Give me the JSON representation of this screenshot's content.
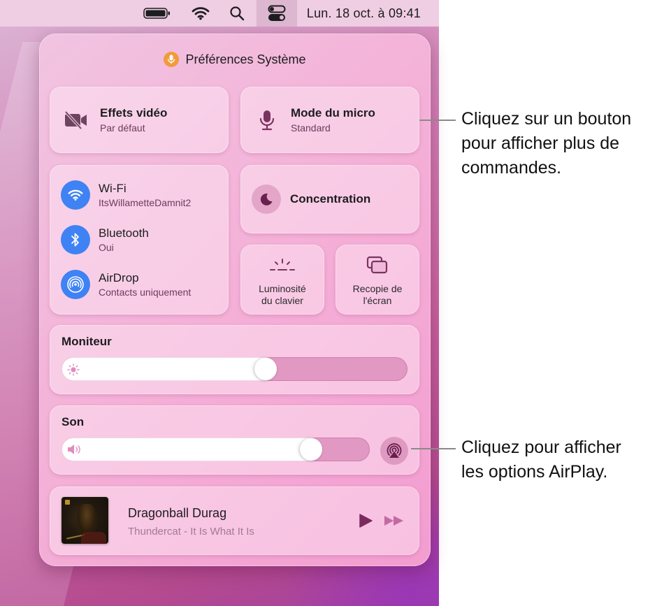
{
  "menubar": {
    "icons": [
      "battery-icon",
      "wifi-icon",
      "search-icon",
      "control-center-icon"
    ],
    "clock": "Lun. 18 oct. à  09:41"
  },
  "panel": {
    "header": {
      "icon": "microphone-icon",
      "icon_color": "#f19b3a",
      "title": "Préférences Système"
    },
    "video_effects": {
      "icon": "video-off-icon",
      "label": "Effets vidéo",
      "value": "Par défaut"
    },
    "mic_mode": {
      "icon": "microphone-icon",
      "label": "Mode du micro",
      "value": "Standard"
    },
    "connectivity": [
      {
        "icon": "wifi-icon",
        "label": "Wi-Fi",
        "value": "ItsWillametteDamnit2"
      },
      {
        "icon": "bluetooth-icon",
        "label": "Bluetooth",
        "value": "Oui"
      },
      {
        "icon": "airdrop-icon",
        "label": "AirDrop",
        "value": "Contacts uniquement"
      }
    ],
    "connectivity_color": "#3f82f4",
    "focus": {
      "icon": "moon-icon",
      "label": "Concentration"
    },
    "keyboard_brightness": {
      "icon": "keyboard-brightness-icon",
      "label_line1": "Luminosité",
      "label_line2": "du clavier"
    },
    "screen_mirroring": {
      "icon": "screen-mirroring-icon",
      "label_line1": "Recopie de",
      "label_line2": "l'écran"
    },
    "display": {
      "label": "Moniteur",
      "icon": "sun-icon",
      "level": 0.59
    },
    "sound": {
      "label": "Son",
      "icon": "speaker-icon",
      "level": 0.81,
      "airplay_icon": "airplay-audio-icon"
    },
    "now_playing": {
      "artwork": "album-art",
      "title": "Dragonball Durag",
      "subtitle": "Thundercat - It Is What It Is",
      "controls": [
        "play-icon",
        "fast-forward-icon"
      ]
    }
  },
  "callouts": [
    {
      "text_line1": "Cliquez sur un bouton",
      "text_line2": "pour afficher plus de",
      "text_line3": "commandes."
    },
    {
      "text_line1": "Cliquez pour afficher",
      "text_line2": "les options AirPlay."
    }
  ]
}
